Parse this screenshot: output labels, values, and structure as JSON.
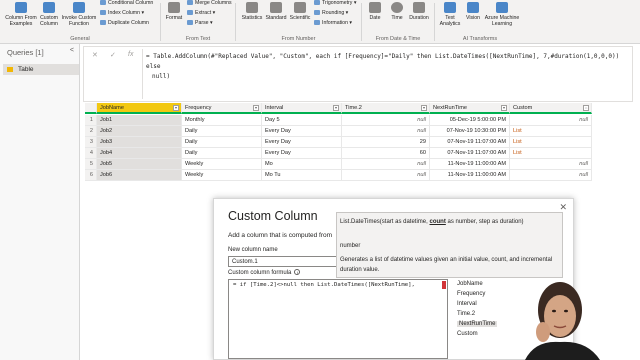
{
  "ribbon": {
    "general": {
      "label": "General",
      "column_from_examples": "Column From Examples",
      "custom_column": "Custom Column",
      "invoke_custom_function": "Invoke Custom Function",
      "conditional_column": "Conditional Column",
      "index_column": "Index Column",
      "duplicate_column": "Duplicate Column"
    },
    "from_text": {
      "label": "From Text",
      "format": "Format",
      "merge_columns": "Merge Columns",
      "extract": "Extract",
      "parse": "Parse"
    },
    "from_number": {
      "label": "From Number",
      "statistics": "Statistics",
      "standard": "Standard",
      "scientific": "Scientific",
      "trigonometry": "Trigonometry",
      "rounding": "Rounding",
      "information": "Information"
    },
    "from_date_time": {
      "label": "From Date & Time",
      "date": "Date",
      "time": "Time",
      "duration": "Duration"
    },
    "ai_transforms": {
      "label": "AI Transforms",
      "text_analytics": "Text Analytics",
      "vision": "Vision",
      "azure_ml": "Azure Machine Learning"
    }
  },
  "queries": {
    "title": "Queries [1]",
    "collapse": "<",
    "items": [
      {
        "label": "Table"
      }
    ]
  },
  "formula_bar": {
    "cancel": "✕",
    "commit": "✓",
    "fx": "fx",
    "line1": "= Table.AddColumn(#\"Replaced Value\", \"Custom\", each if [Frequency]=\"Daily\" then List.DateTimes([NextRunTime], 7,#duration(1,0,0,0)) else",
    "line2": "null)"
  },
  "table": {
    "headers": [
      "JobName",
      "Frequency",
      "Interval",
      "Time.2",
      "NextRunTime",
      "Custom"
    ],
    "rows": [
      {
        "n": "1",
        "job": "Job1",
        "freq": "Monthly",
        "interval": "Day 5",
        "time2": "null",
        "next": "05-Dec-19 5:00:00 PM",
        "custom": "null"
      },
      {
        "n": "2",
        "job": "Job2",
        "freq": "Daily",
        "interval": "Every Day",
        "time2": "null",
        "next": "07-Nov-19 10:30:00 PM",
        "custom": "List"
      },
      {
        "n": "3",
        "job": "Job3",
        "freq": "Daily",
        "interval": "Every Day",
        "time2": "29",
        "next": "07-Nov-19 11:07:00 AM",
        "custom": "List"
      },
      {
        "n": "4",
        "job": "Job4",
        "freq": "Daily",
        "interval": "Every Day",
        "time2": "60",
        "next": "07-Nov-19 11:07:00 AM",
        "custom": "List"
      },
      {
        "n": "5",
        "job": "Job5",
        "freq": "Weekly",
        "interval": "Mo",
        "time2": "null",
        "next": "11-Nov-19 11:00:00 AM",
        "custom": "null"
      },
      {
        "n": "6",
        "job": "Job6",
        "freq": "Weekly",
        "interval": "Mo Tu",
        "time2": "null",
        "next": "11-Nov-19 11:00:00 AM",
        "custom": "null"
      }
    ]
  },
  "dialog": {
    "title": "Custom Column",
    "close": "✕",
    "description": "Add a column that is computed from",
    "name_label": "New column name",
    "name_value": "Custom.1",
    "formula_label": "Custom column formula",
    "formula_info": "i",
    "formula_text": "= if [Time.2]<>null then List.DateTimes([NextRunTime],",
    "available_columns": [
      "JobName",
      "Frequency",
      "Interval",
      "Time.2",
      "NextRunTime",
      "Custom"
    ]
  },
  "tooltip": {
    "sig_prefix": "List.DateTimes(start as datetime, ",
    "sig_bold": "count",
    "sig_suffix": " as number, step as duration)",
    "param_name": "number",
    "description": "Generates a list of datetime values given an initial value, count, and incremental duration value."
  },
  "colors": {
    "ribbon_bg": "#f3f2f1",
    "selected_header": "#f2c811",
    "quality_bar": "#00b050",
    "list_text": "#c55a11"
  }
}
